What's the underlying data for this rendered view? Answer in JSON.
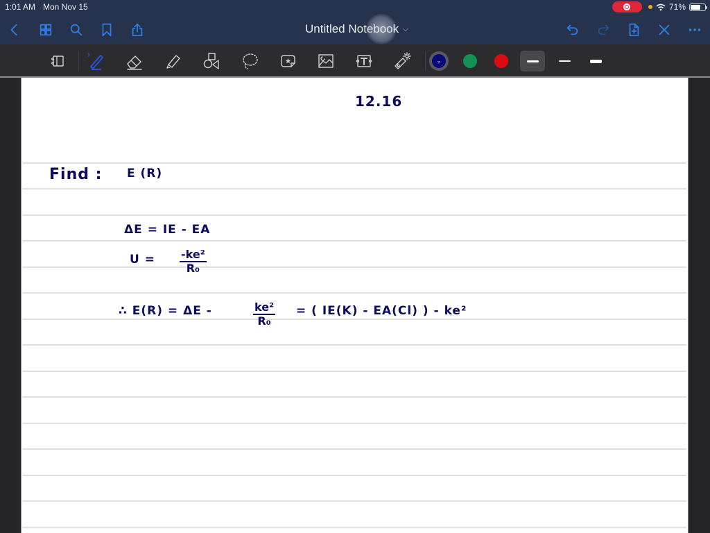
{
  "status_bar": {
    "time": "1:01 AM",
    "date": "Mon Nov 15",
    "battery_percent": "71%",
    "battery_level": 0.71,
    "recording_indicator": "screen-recording",
    "colors": {
      "recording": "#e2263a",
      "privacy_dot": "#f5a623"
    }
  },
  "nav": {
    "title": "Untitled Notebook",
    "left_icons": [
      "back-icon",
      "thumbnails-icon",
      "search-icon",
      "bookmark-icon",
      "share-icon"
    ],
    "right_icons": [
      "undo-icon",
      "redo-icon",
      "add-page-icon",
      "close-icon",
      "more-icon"
    ],
    "accent_color": "#2f7be2"
  },
  "toolbar": {
    "tools": [
      "page-layout",
      "pen",
      "eraser",
      "highlighter",
      "shapes",
      "lasso",
      "sticker",
      "image",
      "text-box",
      "laser-pointer"
    ],
    "active_tool": "pen",
    "colors": [
      {
        "name": "navy",
        "hex": "#0a0a7a",
        "selected": true
      },
      {
        "name": "green",
        "hex": "#139253",
        "selected": false
      },
      {
        "name": "red",
        "hex": "#dd0b12",
        "selected": false
      }
    ],
    "stroke_widths": [
      "medium",
      "thin",
      "thick"
    ],
    "active_stroke": "medium"
  },
  "notes": {
    "problem_number": "12.16",
    "find_label": "Find :",
    "find_target": "E (R)",
    "line1": "ΔE = IE - EA",
    "line2_lhs": "U =",
    "line2_num": "-ke²",
    "line2_den": "R₀",
    "line3_prefix": "∴  E(R) =  ΔE -",
    "line3_num": "ke²",
    "line3_den": "R₀",
    "line3_rest": "=  (  IE(K) -  EA(Cl)  ) -   ke²"
  }
}
